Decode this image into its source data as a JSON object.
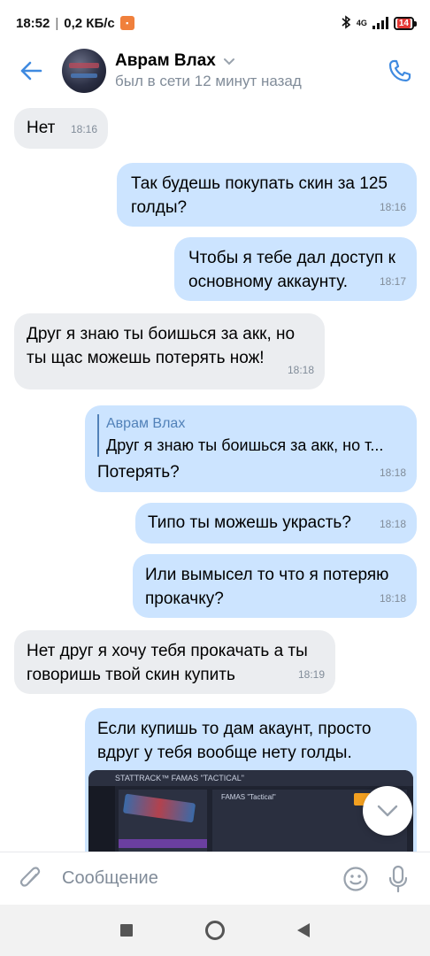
{
  "status_bar": {
    "time": "18:52",
    "speed": "0,2 КБ/с",
    "network": "4G",
    "battery": "14"
  },
  "header": {
    "name": "Аврам Влах",
    "status": "был в сети 12 минут назад"
  },
  "messages": [
    {
      "dir": "in",
      "text": "Нет",
      "time": "18:16"
    },
    {
      "dir": "out",
      "text": "Так будешь покупать скин за 125\nголды?",
      "time": "18:16"
    },
    {
      "dir": "out",
      "text": "Чтобы я тебе дал доступ к\nосновному аккаунту.",
      "time": "18:17"
    },
    {
      "dir": "in",
      "text": "Друг я знаю ты боишься за акк, но\nты щас можешь потерять нож!",
      "time": "18:18"
    },
    {
      "dir": "out",
      "reply_author": "Аврам Влах",
      "reply_text": "Друг я знаю ты боишься за акк, но т...",
      "text": "Потерять?",
      "time": "18:18"
    },
    {
      "dir": "out",
      "text": "Типо ты можешь украсть?",
      "time": "18:18"
    },
    {
      "dir": "out",
      "text": "Или вымысел то что я потеряю\nпрокачку?",
      "time": "18:18"
    },
    {
      "dir": "in",
      "text": "Нет друг я хочу тебя прокачать а ты\nговоришь твой скин купить",
      "time": "18:19"
    },
    {
      "dir": "out",
      "text": "Если купишь то дам акаунт, просто\nвдруг у тебя вообще нету голды.",
      "time": ""
    }
  ],
  "screenshot_labels": {
    "title": "STATTRACK™ FAMAS \"TACTICAL\"",
    "item": "FAMAS \"Tactical\""
  },
  "composer": {
    "placeholder": "Сообщение"
  },
  "colors": {
    "accent": "#3f8ae0",
    "bubble_in": "#ebedf0",
    "bubble_out": "#cce4ff"
  }
}
